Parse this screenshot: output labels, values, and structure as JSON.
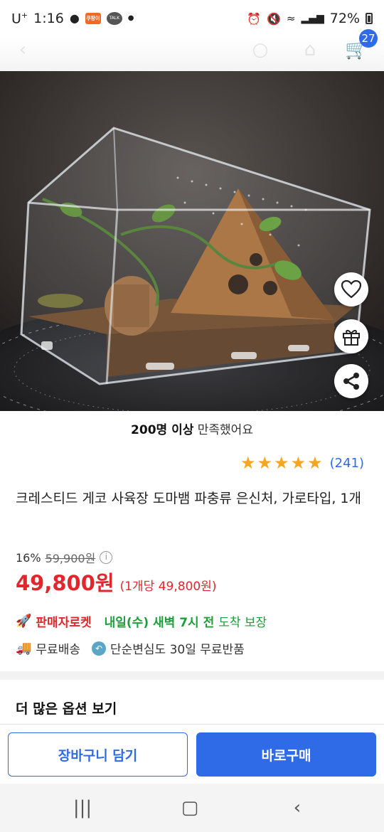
{
  "status_bar": {
    "carrier": "U",
    "carrier_sup": "+",
    "time": "1:16",
    "battery": "72%",
    "app_badge": "쿠팡이츠",
    "talk_label": "TALK"
  },
  "header": {
    "cart_count": "27"
  },
  "product": {
    "satisfaction_bold": "200명 이상",
    "satisfaction_text": " 만족했어요",
    "rating": 5,
    "review_count": "(241)",
    "title": "크레스티드 게코 사육장 도마뱀 파충류 은신처, 가로타입, 1개",
    "discount": "16%",
    "original_price": "59,900원",
    "sale_price": "49,800원",
    "unit_price": "(1개당 49,800원)",
    "seller_rocket": "판매자로켓",
    "arrival_bold": "내일(수) 새벽 7시 전",
    "arrival_rest": "도착 보장",
    "shipping": "무료배송",
    "returns": "단순변심도 30일 무료반품"
  },
  "more_options": "더 많은 옵션 보기",
  "actions": {
    "add_to_cart": "장바구니 담기",
    "buy_now": "바로구매"
  },
  "colors": {
    "accent_blue": "#2f6be6",
    "price_red": "#e3262d",
    "delivery_green": "#1e9e3a",
    "star": "#f5a623"
  },
  "icons": [
    "heart-icon",
    "gift-icon",
    "share-icon",
    "truck-icon",
    "return-icon",
    "rocket-icon",
    "info-icon"
  ]
}
